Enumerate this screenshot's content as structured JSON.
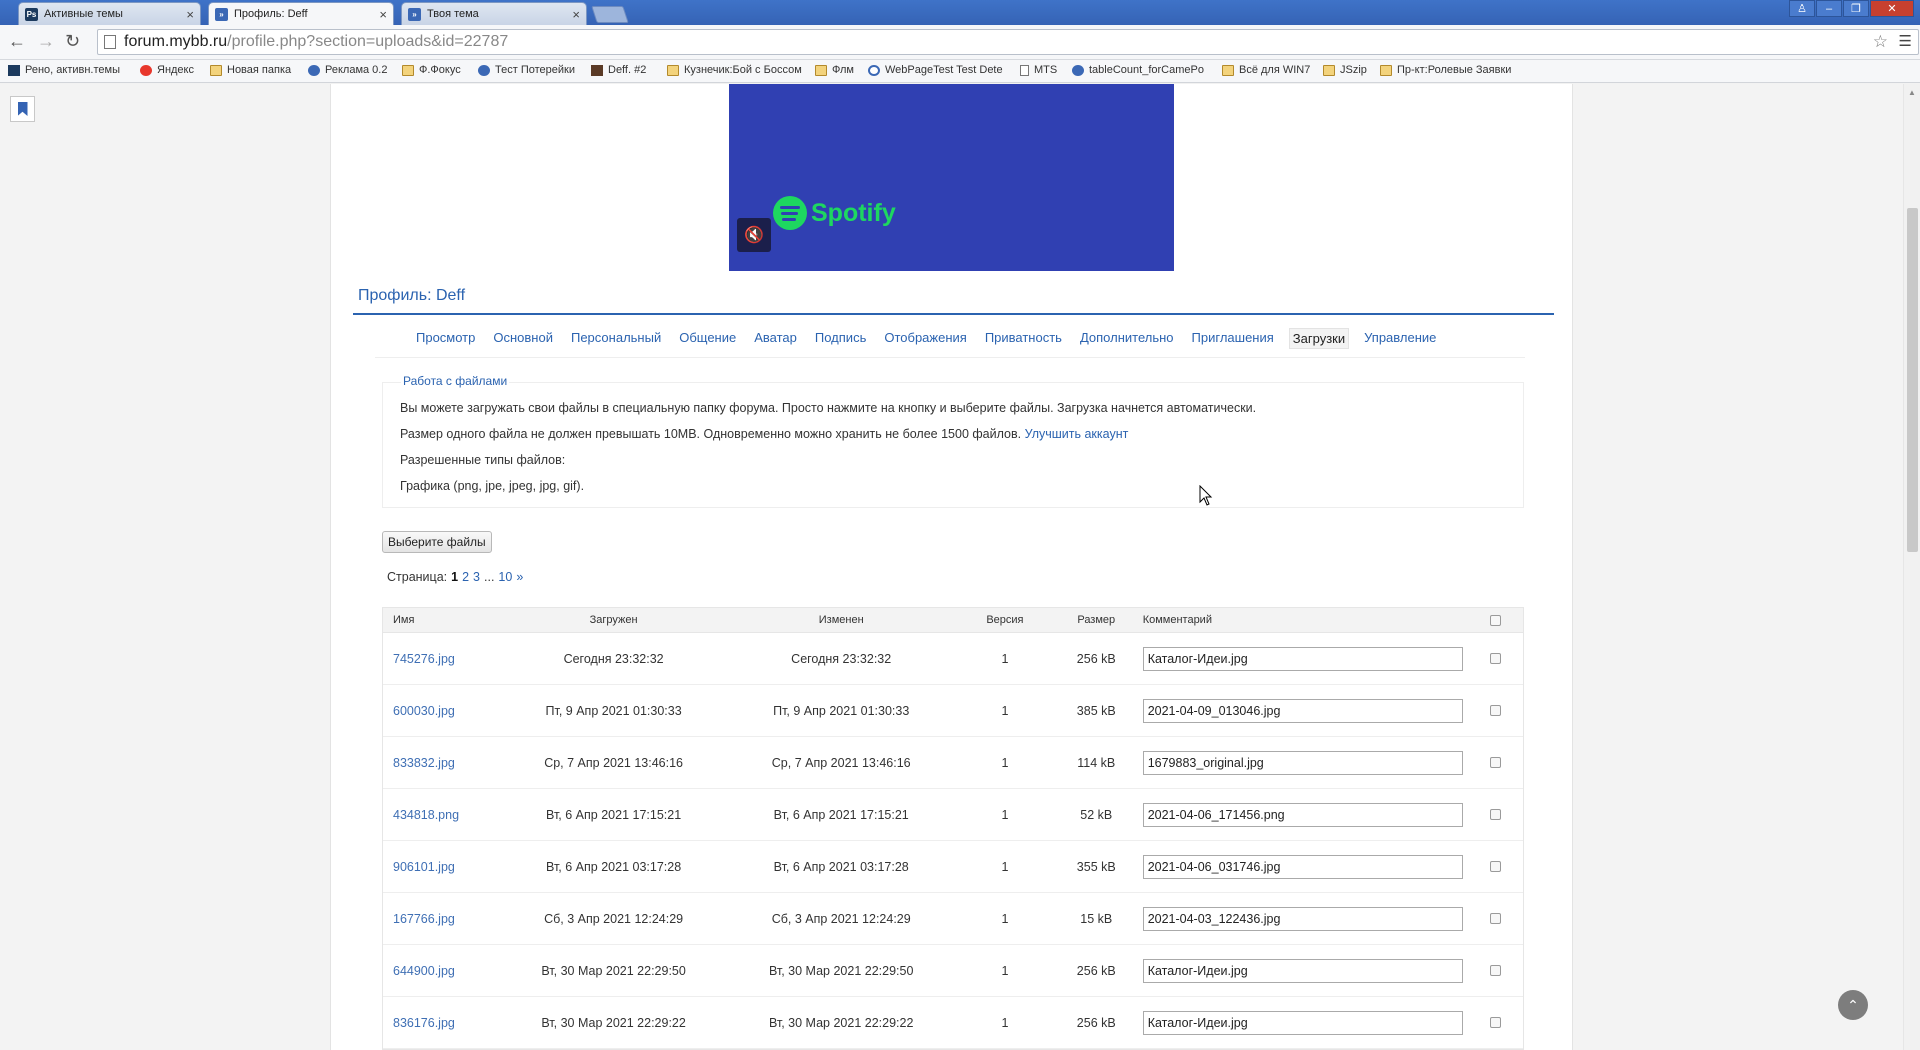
{
  "browser": {
    "tabs": [
      {
        "title": "Активные темы",
        "icon": "photoshop-icon",
        "active": false
      },
      {
        "title": "Профиль: Deff",
        "icon": "mybb-icon",
        "active": true
      },
      {
        "title": "Твоя тема",
        "icon": "mybb-icon",
        "active": false
      }
    ],
    "url_host": "forum.mybb.ru",
    "url_path": "/profile.php?section=uploads&id=22787",
    "bookmarks": [
      {
        "label": "Рено, активн.темы",
        "icon": "photoshop-icon"
      },
      {
        "label": "Яндекс",
        "icon": "yandex-icon"
      },
      {
        "label": "Новая папка",
        "icon": "folder-icon"
      },
      {
        "label": "Реклама 0.2",
        "icon": "mybb-icon"
      },
      {
        "label": "Ф.Фокус",
        "icon": "folder-icon"
      },
      {
        "label": "Тест Потерейки",
        "icon": "mybb-icon"
      },
      {
        "label": "Deff. #2",
        "icon": "avatar-icon"
      },
      {
        "label": "Кузнечик:Бой с Боссом",
        "icon": "folder-icon"
      },
      {
        "label": "Флм",
        "icon": "folder-icon"
      },
      {
        "label": "WebPageTest Test Dete",
        "icon": "webpagetest-icon"
      },
      {
        "label": "MTS",
        "icon": "page-icon"
      },
      {
        "label": "tableCount_forCamePo",
        "icon": "mybb-icon"
      },
      {
        "label": "Всё для WIN7",
        "icon": "folder-icon"
      },
      {
        "label": "JSzip",
        "icon": "folder-icon"
      },
      {
        "label": "Пр-кт:Ролевые Заявки",
        "icon": "folder-icon"
      }
    ]
  },
  "video": {
    "brand": "Spotify",
    "mute_icon": "mute-icon"
  },
  "profile": {
    "title": "Профиль: Deff",
    "tabs": [
      "Просмотр",
      "Основной",
      "Персональный",
      "Общение",
      "Аватар",
      "Подпись",
      "Отображения",
      "Приватность",
      "Дополнительно",
      "Приглашения",
      "Загрузки",
      "Управление"
    ],
    "active_tab": "Загрузки"
  },
  "files_panel": {
    "legend": "Работа с файлами",
    "line1": "Вы можете загружать свои файлы в специальную папку форума. Просто нажмите на кнопку и выберите файлы. Загрузка начнется автоматически.",
    "line2": "Размер одного файла не должен превышать 10MB. Одновременно можно хранить не более 1500 файлов.",
    "upgrade_link": "Улучшить аккаунт",
    "line3": "Разрешенные типы файлов:",
    "line4": "Графика (png, jpe, jpeg, jpg, gif)."
  },
  "choose_button": "Выберите файлы",
  "pager": {
    "label": "Страница:",
    "current": "1",
    "pages": [
      "2",
      "3"
    ],
    "ellipsis": "...",
    "last": "10",
    "next": "»"
  },
  "table": {
    "headers": {
      "name": "Имя",
      "uploaded": "Загружен",
      "modified": "Изменен",
      "version": "Версия",
      "size": "Размер",
      "comment": "Комментарий"
    },
    "rows": [
      {
        "name": "745276.jpg",
        "uploaded": "Сегодня 23:32:32",
        "modified": "Сегодня 23:32:32",
        "version": "1",
        "size": "256 kB",
        "comment": "Каталог-Идеи.jpg"
      },
      {
        "name": "600030.jpg",
        "uploaded": "Пт, 9 Апр 2021 01:30:33",
        "modified": "Пт, 9 Апр 2021 01:30:33",
        "version": "1",
        "size": "385 kB",
        "comment": "2021-04-09_013046.jpg"
      },
      {
        "name": "833832.jpg",
        "uploaded": "Ср, 7 Апр 2021 13:46:16",
        "modified": "Ср, 7 Апр 2021 13:46:16",
        "version": "1",
        "size": "114 kB",
        "comment": "1679883_original.jpg"
      },
      {
        "name": "434818.png",
        "uploaded": "Вт, 6 Апр 2021 17:15:21",
        "modified": "Вт, 6 Апр 2021 17:15:21",
        "version": "1",
        "size": "52 kB",
        "comment": "2021-04-06_171456.png"
      },
      {
        "name": "906101.jpg",
        "uploaded": "Вт, 6 Апр 2021 03:17:28",
        "modified": "Вт, 6 Апр 2021 03:17:28",
        "version": "1",
        "size": "355 kB",
        "comment": "2021-04-06_031746.jpg"
      },
      {
        "name": "167766.jpg",
        "uploaded": "Сб, 3 Апр 2021 12:24:29",
        "modified": "Сб, 3 Апр 2021 12:24:29",
        "version": "1",
        "size": "15 kB",
        "comment": "2021-04-03_122436.jpg"
      },
      {
        "name": "644900.jpg",
        "uploaded": "Вт, 30 Мар 2021 22:29:50",
        "modified": "Вт, 30 Мар 2021 22:29:50",
        "version": "1",
        "size": "256 kB",
        "comment": "Каталог-Идеи.jpg"
      },
      {
        "name": "836176.jpg",
        "uploaded": "Вт, 30 Мар 2021 22:29:22",
        "modified": "Вт, 30 Мар 2021 22:29:22",
        "version": "1",
        "size": "256 kB",
        "comment": "Каталог-Идеи.jpg"
      }
    ]
  },
  "colors": {
    "link": "#2b63b0",
    "spotify_green": "#1ed760",
    "video_bg": "#3040b2"
  }
}
